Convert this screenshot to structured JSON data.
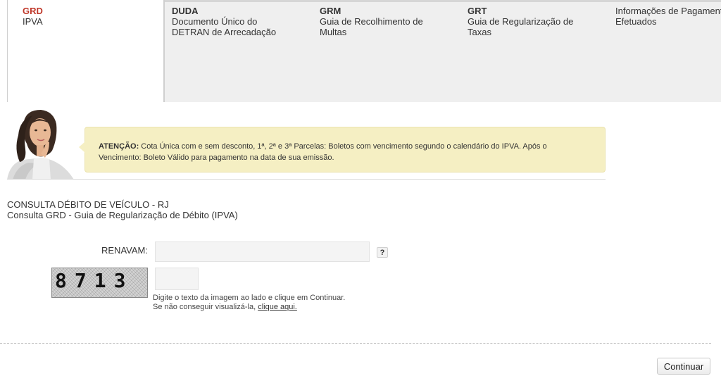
{
  "tabs": [
    {
      "code": "GRD",
      "desc1": "IPVA",
      "desc2": ""
    },
    {
      "code": "DUDA",
      "desc1": "Documento Único do",
      "desc2": "DETRAN de Arrecadação"
    },
    {
      "code": "GRM",
      "desc1": "Guia de Recolhimento de",
      "desc2": "Multas"
    },
    {
      "code": "GRT",
      "desc1": "Guia de Regularização de",
      "desc2": "Taxas"
    },
    {
      "code": "",
      "desc1": "Informações de Pagamentos",
      "desc2": "Efetuados"
    }
  ],
  "notice": {
    "label": "ATENÇÃO:",
    "line1": " Cota Única com e sem desconto, 1ª, 2ª e 3ª Parcelas: Boletos com vencimento segundo o calendário do IPVA. Após o",
    "line2": "Vencimento: Boleto Válido para pagamento na data de sua emissão."
  },
  "page": {
    "title": "CONSULTA DÉBITO DE VEÍCULO - RJ",
    "subtitle": "Consulta GRD - Guia de Regularização de Débito (IPVA)"
  },
  "form": {
    "renavam_label": "RENAVAM:",
    "renavam_value": "",
    "help_label": "?",
    "captcha_text": "8713",
    "captcha_value": "",
    "hint_line1": "Digite o texto da imagem ao lado e clique em Continuar.",
    "hint_line2": "Se não conseguir visualizá-la, ",
    "hint_link": "clique aqui.",
    "continue_label": "Continuar"
  },
  "colors": {
    "active_tab_code": "#c0392b",
    "notice_bg": "#f5efc3",
    "tab_bar_bg": "#efefef"
  }
}
